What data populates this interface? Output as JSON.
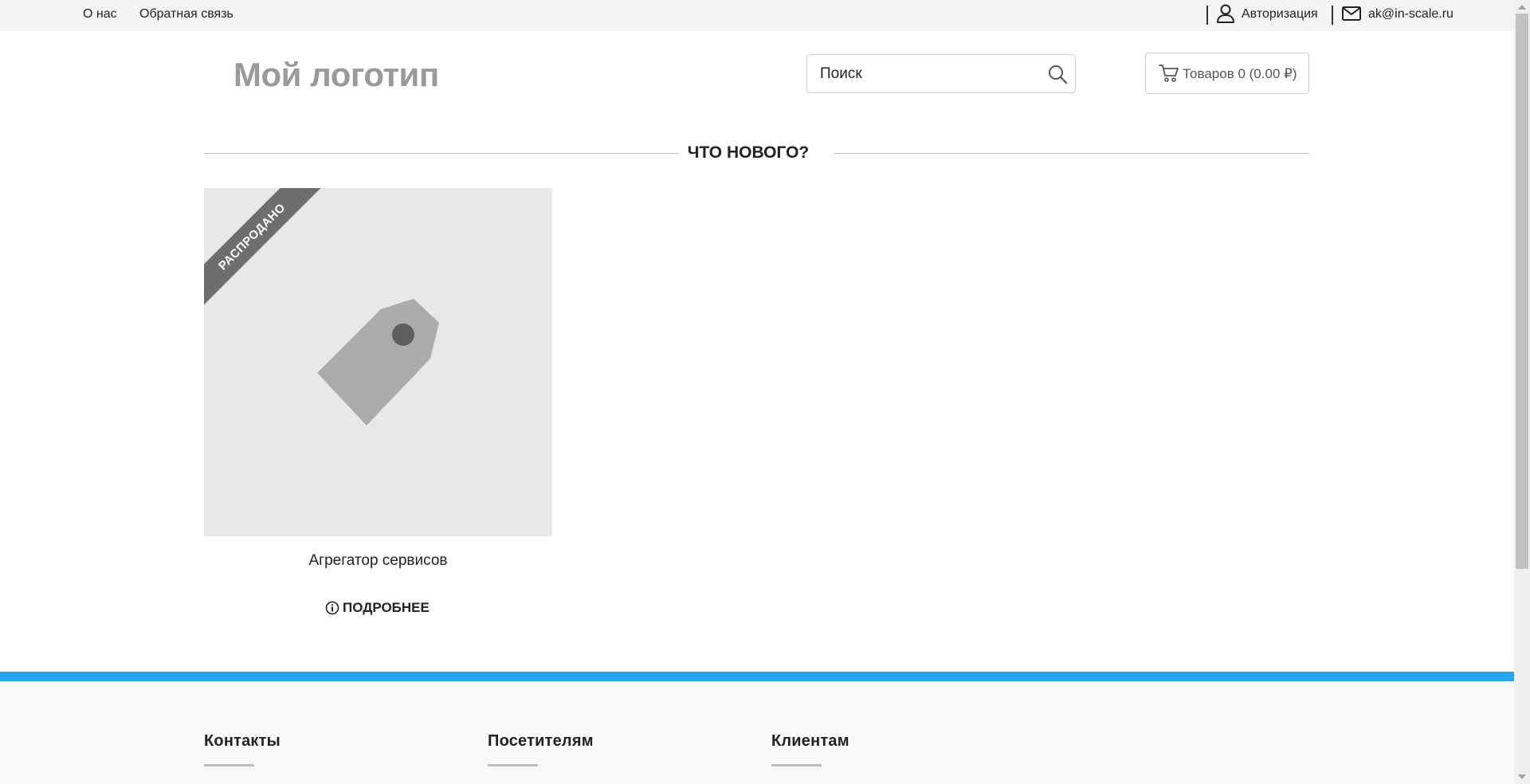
{
  "topbar": {
    "about": "О нас",
    "feedback": "Обратная связь",
    "login": "Авторизация",
    "email": "ak@in-scale.ru",
    "icons": {
      "login": "user-icon",
      "email": "envelope-icon"
    }
  },
  "header": {
    "logo": "Мой логотип",
    "search_placeholder": "Поиск",
    "cart_label": "Товаров 0 (0.00 ₽)",
    "icons": {
      "search": "search-icon",
      "cart": "cart-icon"
    }
  },
  "section": {
    "title": "ЧТО НОВОГО?"
  },
  "products": [
    {
      "name": "Агрегатор сервисов",
      "badge": "РАСПРОДАНО",
      "more_label": "ПОДРОБНЕЕ",
      "icons": {
        "image": "price-tag-icon",
        "more": "info-icon"
      }
    }
  ],
  "footer": {
    "columns": [
      "Контакты",
      "Посетителям",
      "Клиентам"
    ]
  },
  "colors": {
    "accent": "#22a6ee",
    "topbar_bg": "#f3f4f6",
    "logo": "#9a9a9a",
    "ribbon": "#6e6e6e"
  }
}
